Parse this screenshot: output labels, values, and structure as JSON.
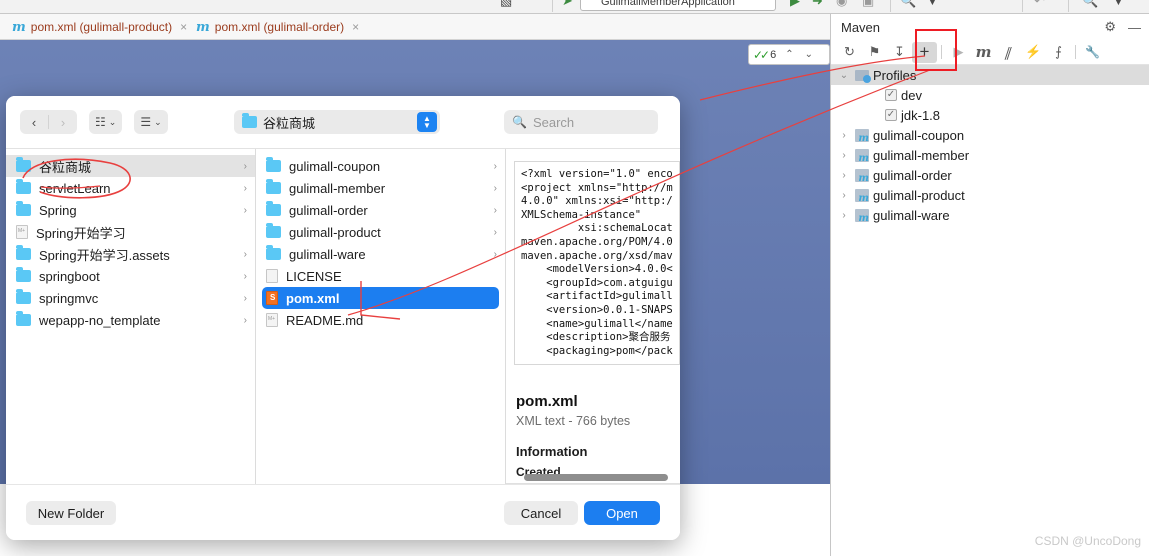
{
  "ide": {
    "run_config": "GulimallMemberApplication",
    "inspection": {
      "count": "6",
      "up": "⌃",
      "down": "⌄"
    }
  },
  "tabs": [
    {
      "label": "pom.xml (gulimall-product)",
      "icon": "maven-file-icon",
      "close": "×"
    },
    {
      "label": "pom.xml (gulimall-order)",
      "icon": "maven-file-icon",
      "close": "×"
    }
  ],
  "maven": {
    "title": "Maven",
    "header_actions": [
      {
        "name": "settings-gear-icon",
        "glyph": "⚙"
      },
      {
        "name": "hide-panel-icon",
        "glyph": "—"
      }
    ],
    "toolbar": [
      {
        "name": "reload-projects-icon",
        "glyph": "↻",
        "active": false
      },
      {
        "name": "generate-sources-icon",
        "glyph": "⚑",
        "active": false
      },
      {
        "name": "download-sources-icon",
        "glyph": "↧",
        "active": false
      },
      {
        "name": "add-maven-project-icon",
        "glyph": "+",
        "active": true
      },
      {
        "name": "run-icon",
        "glyph": "▶",
        "active": false
      },
      {
        "name": "execute-maven-goal-icon",
        "glyph": "m",
        "active": false
      },
      {
        "name": "toggle-skip-tests-icon",
        "glyph": "∥",
        "active": false
      },
      {
        "name": "execute-icon",
        "glyph": "⚡",
        "active": false
      },
      {
        "name": "collapse-all-icon",
        "glyph": "⨍",
        "active": false
      },
      {
        "name": "maven-settings-wrench-icon",
        "glyph": "🔧",
        "active": false
      }
    ],
    "tree": [
      {
        "label": "Profiles",
        "kind": "profiles",
        "twisty": "⌄",
        "selected": true,
        "indent": 0
      },
      {
        "label": "dev",
        "kind": "checkbox",
        "checked": "✓",
        "indent": 1
      },
      {
        "label": "jdk-1.8",
        "kind": "checkbox",
        "checked": "✓",
        "indent": 1
      },
      {
        "label": "gulimall-coupon",
        "kind": "module",
        "twisty": "›",
        "indent": 0
      },
      {
        "label": "gulimall-member",
        "kind": "module",
        "twisty": "›",
        "indent": 0
      },
      {
        "label": "gulimall-order",
        "kind": "module",
        "twisty": "›",
        "indent": 0
      },
      {
        "label": "gulimall-product",
        "kind": "module",
        "twisty": "›",
        "indent": 0
      },
      {
        "label": "gulimall-ware",
        "kind": "module",
        "twisty": "›",
        "indent": 0
      }
    ]
  },
  "dialog": {
    "nav": {
      "back": "‹",
      "forward": "›"
    },
    "view_columns": {
      "glyph": "☷",
      "chevron": "⌄"
    },
    "view_group": {
      "glyph": "☰",
      "chevron": "⌄"
    },
    "path": {
      "label": "谷粒商城",
      "stepper_up": "▲",
      "stepper_down": "▼"
    },
    "search": {
      "placeholder": "Search",
      "icon": "search-icon"
    },
    "column1": [
      {
        "label": "谷粒商城",
        "type": "folder",
        "chevron": "›",
        "state": "selected-gray"
      },
      {
        "label": "servletLearn",
        "type": "folder",
        "chevron": "›",
        "state": ""
      },
      {
        "label": "Spring",
        "type": "folder",
        "chevron": "›",
        "state": ""
      },
      {
        "label": "Spring开始学习",
        "type": "markdown",
        "chevron": "",
        "state": ""
      },
      {
        "label": "Spring开始学习.assets",
        "type": "folder",
        "chevron": "›",
        "state": ""
      },
      {
        "label": "springboot",
        "type": "folder",
        "chevron": "›",
        "state": ""
      },
      {
        "label": "springmvc",
        "type": "folder",
        "chevron": "›",
        "state": ""
      },
      {
        "label": "wepapp-no_template",
        "type": "folder",
        "chevron": "›",
        "state": ""
      }
    ],
    "column2": [
      {
        "label": "gulimall-coupon",
        "type": "folder",
        "chevron": "›",
        "state": ""
      },
      {
        "label": "gulimall-member",
        "type": "folder",
        "chevron": "›",
        "state": ""
      },
      {
        "label": "gulimall-order",
        "type": "folder",
        "chevron": "›",
        "state": ""
      },
      {
        "label": "gulimall-product",
        "type": "folder",
        "chevron": "›",
        "state": ""
      },
      {
        "label": "gulimall-ware",
        "type": "folder",
        "chevron": "›",
        "state": ""
      },
      {
        "label": "LICENSE",
        "type": "file",
        "chevron": "",
        "state": ""
      },
      {
        "label": "pom.xml",
        "type": "xml",
        "chevron": "",
        "state": "selected-blue"
      },
      {
        "label": "README.md",
        "type": "markdown",
        "chevron": "",
        "state": ""
      }
    ],
    "preview": {
      "code": "<?xml version=\"1.0\" enco\n<project xmlns=\"http://m\n4.0.0\" xmlns:xsi=\"http:/\nXMLSchema-instance\"\n         xsi:schemaLocat\nmaven.apache.org/POM/4.0\nmaven.apache.org/xsd/mav\n    <modelVersion>4.0.0<\n    <groupId>com.atguigu\n    <artifactId>gulimall\n    <version>0.0.1-SNAPS\n    <name>gulimall</name\n    <description>聚合服务\n    <packaging>pom</pack",
      "filename": "pom.xml",
      "meta": "XML text - 766 bytes",
      "info_heading": "Information",
      "created_label": "Created"
    },
    "footer": {
      "new_folder": "New Folder",
      "cancel": "Cancel",
      "open": "Open"
    }
  },
  "watermark": "CSDN @UncoDong",
  "colors": {
    "editor_blue": "#6d82b6",
    "accent_blue": "#1c7ef0",
    "annotation_red": "#ee1c24",
    "tab_text": "#9b3c1e"
  }
}
